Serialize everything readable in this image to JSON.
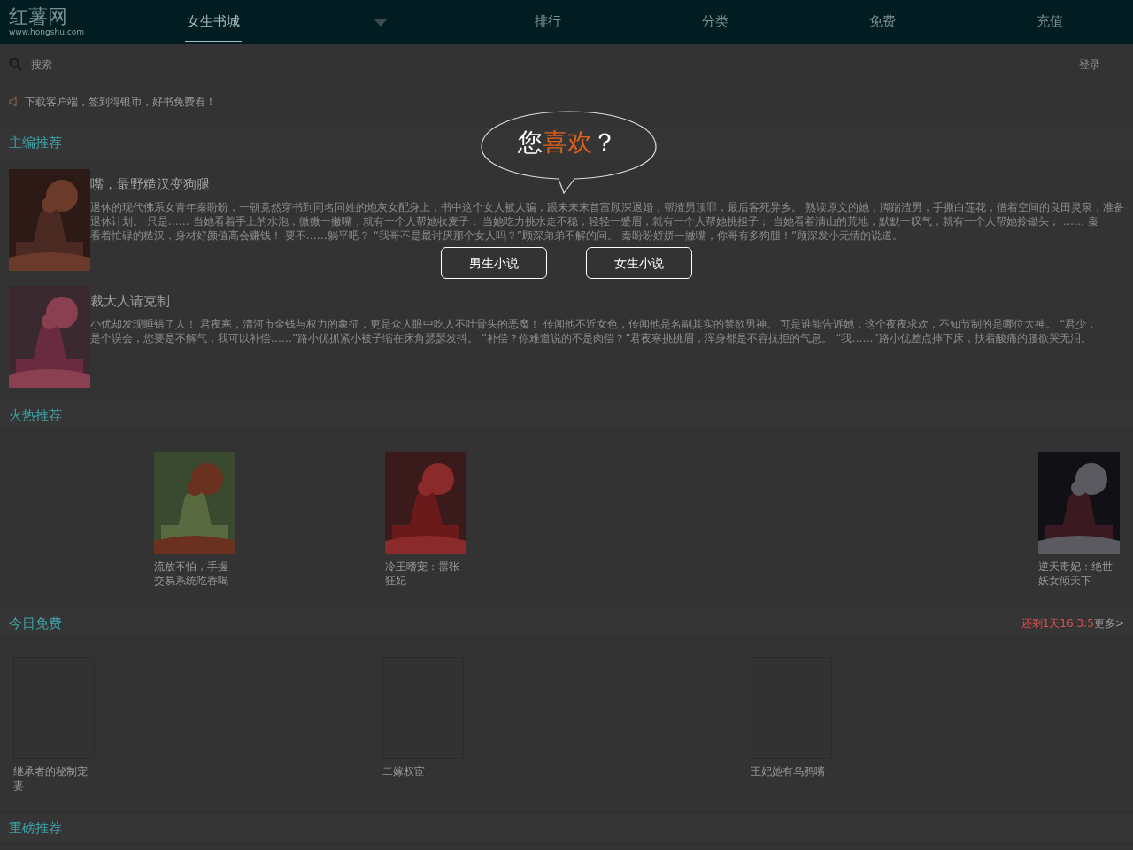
{
  "logo": {
    "name": "红薯网",
    "url": "www.hongshu.com"
  },
  "nav": [
    {
      "label": "女生书城",
      "kind": "tab",
      "selected": true
    },
    {
      "kind": "dropdown",
      "selected": false
    },
    {
      "label": "排行",
      "kind": "tab",
      "selected": false
    },
    {
      "label": "分类",
      "kind": "tab",
      "selected": false
    },
    {
      "label": "免费",
      "kind": "tab",
      "selected": false
    },
    {
      "label": "充值",
      "kind": "tab",
      "selected": false
    }
  ],
  "search": {
    "placeholder": "搜索"
  },
  "login": "登录",
  "notice": "下载客户端，签到得银币，好书免费看！",
  "sections": [
    {
      "title": "主编推荐",
      "kind": "list",
      "books": [
        {
          "title": "嘴，最野糙汉变狗腿",
          "lines": [
            "退休的现代佛系女青年秦盼盼，一朝竟然穿书到同名同姓的炮灰女配身上，书中这个女人被人骗，跟未来末首富顾深退婚，帮渣男顶罪，最后客死异乡。 熟读原文的她，脚踹渣男，手撕白莲花，借着空间的良田灵泉，准备",
            "退休计划。 只是…… 当她看着手上的水泡，微微一撇嘴，就有一个人帮她收麦子； 当她吃力挑水走不稳，轻轻一蹙眉，就有一个人帮她挑担子； 当她看着满山的荒地，默默一叹气，就有一个人帮她拎锄头； …… 秦",
            "看着忙碌的糙汉，身材好颜值高会赚钱！ 要不……躺平吧？ “我哥不是最讨厌那个女人吗？”顾深弟弟不解的问。 秦盼盼娇娇一撇嘴，你哥有多狗腿！”顾深发小无情的说道。"
          ]
        },
        {
          "title": "裁大人请克制",
          "lines": [
            "小优却发现睡错了人！ 君夜寒，清河市金钱与权力的象征，更是众人眼中吃人不吐骨头的恶魔！ 传闻他不近女色，传闻他是名副其实的禁欲男神。 可是谁能告诉她，这个夜夜求欢，不知节制的是哪位大神。 “君少，",
            "是个误会，您要是不解气，我可以补偿……”路小优抓紧小被子缩在床角瑟瑟发抖。 “补偿？你难道说的不是肉偿？”君夜寒挑挑眉，浑身都是不容抗拒的气息。 “我……”路小优差点摔下床，扶着酸痛的腰欲哭无泪。"
          ]
        }
      ]
    },
    {
      "title": "火热推荐",
      "kind": "grid",
      "books": [
        {
          "title": "流放不怕，手握交易系统吃香喝"
        },
        {
          "title": "冷王嗜宠：嚣张狂妃"
        },
        {
          "title": "逆天毒妃：绝世妖女倾天下"
        }
      ]
    },
    {
      "title": "今日免费",
      "kind": "free",
      "countdown": "还剩1天16:3:5",
      "more": "更多>",
      "books": [
        {
          "title": "继承者的秘制宠妻"
        },
        {
          "title": "二嫁权宦"
        },
        {
          "title": "王妃她有乌鸦嘴"
        }
      ]
    },
    {
      "title": "重磅推荐",
      "kind": "header"
    }
  ],
  "dialog": {
    "question": [
      {
        "text": "您",
        "kind": "plain"
      },
      {
        "text": "喜欢",
        "kind": "accent"
      },
      {
        "text": "？",
        "kind": "plain"
      }
    ],
    "buttons": [
      "男生小说",
      "女生小说"
    ]
  }
}
